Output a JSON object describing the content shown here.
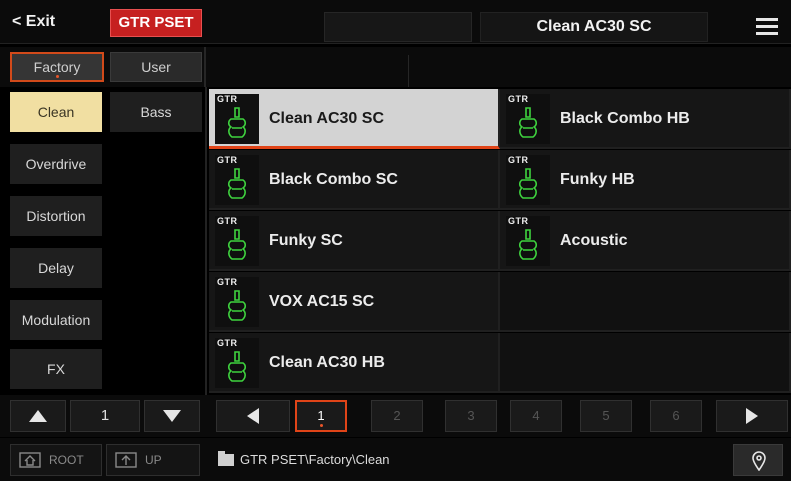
{
  "topbar": {
    "exit_label": "< Exit",
    "mode_label": "GTR PSET",
    "preset_title": "Clean AC30 SC",
    "menu_icon": "hamburger-menu-icon"
  },
  "tabs": {
    "factory": "Factory",
    "user": "User",
    "active": "Factory"
  },
  "categories": {
    "left": [
      "Clean",
      "Overdrive",
      "Distortion",
      "Delay",
      "Modulation",
      "FX"
    ],
    "right": [
      "Bass"
    ],
    "selected": "Clean"
  },
  "presets": {
    "badge": "GTR",
    "icon": "electric-guitar-icon",
    "items": [
      "Clean AC30 SC",
      "Black Combo HB",
      "Black Combo SC",
      "Funky HB",
      "Funky SC",
      "Acoustic",
      "VOX AC15 SC",
      "",
      "Clean AC30 HB",
      ""
    ],
    "selected": "Clean AC30 SC"
  },
  "category_pager": {
    "page": "1"
  },
  "pager": {
    "pages": [
      "1",
      "2",
      "3",
      "4",
      "5",
      "6"
    ],
    "current": "1"
  },
  "bottombar": {
    "root_label": "ROOT",
    "up_label": "UP",
    "path": "GTR PSET\\Factory\\Clean",
    "location_icon": "location-pin-icon"
  },
  "colors": {
    "accent_red": "#c62020",
    "selection_orange": "#e04418",
    "category_selected": "#f1dfa2",
    "guitar_green": "#3fd43f"
  }
}
